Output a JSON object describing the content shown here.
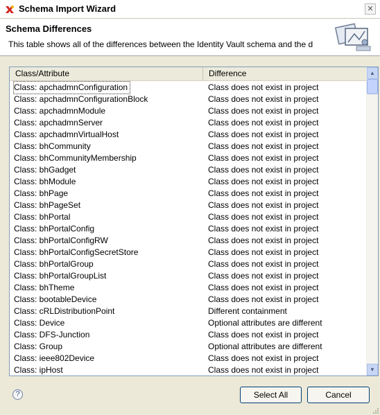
{
  "window": {
    "title": "Schema Import Wizard"
  },
  "header": {
    "title": "Schema Differences",
    "description": "This table shows all of the differences between the Identity Vault schema and the d"
  },
  "table": {
    "columns": [
      "Class/Attribute",
      "Difference"
    ],
    "rows": [
      {
        "name": "Class: apchadmnConfiguration",
        "diff": "Class does not exist in project"
      },
      {
        "name": "Class: apchadmnConfigurationBlock",
        "diff": "Class does not exist in project"
      },
      {
        "name": "Class: apchadmnModule",
        "diff": "Class does not exist in project"
      },
      {
        "name": "Class: apchadmnServer",
        "diff": "Class does not exist in project"
      },
      {
        "name": "Class: apchadmnVirtualHost",
        "diff": "Class does not exist in project"
      },
      {
        "name": "Class: bhCommunity",
        "diff": "Class does not exist in project"
      },
      {
        "name": "Class: bhCommunityMembership",
        "diff": "Class does not exist in project"
      },
      {
        "name": "Class: bhGadget",
        "diff": "Class does not exist in project"
      },
      {
        "name": "Class: bhModule",
        "diff": "Class does not exist in project"
      },
      {
        "name": "Class: bhPage",
        "diff": "Class does not exist in project"
      },
      {
        "name": "Class: bhPageSet",
        "diff": "Class does not exist in project"
      },
      {
        "name": "Class: bhPortal",
        "diff": "Class does not exist in project"
      },
      {
        "name": "Class: bhPortalConfig",
        "diff": "Class does not exist in project"
      },
      {
        "name": "Class: bhPortalConfigRW",
        "diff": "Class does not exist in project"
      },
      {
        "name": "Class: bhPortalConfigSecretStore",
        "diff": "Class does not exist in project"
      },
      {
        "name": "Class: bhPortalGroup",
        "diff": "Class does not exist in project"
      },
      {
        "name": "Class: bhPortalGroupList",
        "diff": "Class does not exist in project"
      },
      {
        "name": "Class: bhTheme",
        "diff": "Class does not exist in project"
      },
      {
        "name": "Class: bootableDevice",
        "diff": "Class does not exist in project"
      },
      {
        "name": "Class: cRLDistributionPoint",
        "diff": "Different containment"
      },
      {
        "name": "Class: Device",
        "diff": "Optional attributes are different"
      },
      {
        "name": "Class: DFS-Junction",
        "diff": "Class does not exist in project"
      },
      {
        "name": "Class: Group",
        "diff": "Optional attributes are different"
      },
      {
        "name": "Class: ieee802Device",
        "diff": "Class does not exist in project"
      },
      {
        "name": "Class: ipHost",
        "diff": "Class does not exist in project"
      }
    ]
  },
  "buttons": {
    "select_all": "Select All",
    "cancel": "Cancel",
    "help": "?"
  },
  "icons": {
    "app": "wizard-app-icon",
    "close": "close-icon",
    "help": "help-icon",
    "banner": "schema-wizard-banner-icon"
  },
  "colors": {
    "table_border": "#7f9db9",
    "button_border": "#003c74",
    "dialog_bg": "#ece9d8"
  }
}
